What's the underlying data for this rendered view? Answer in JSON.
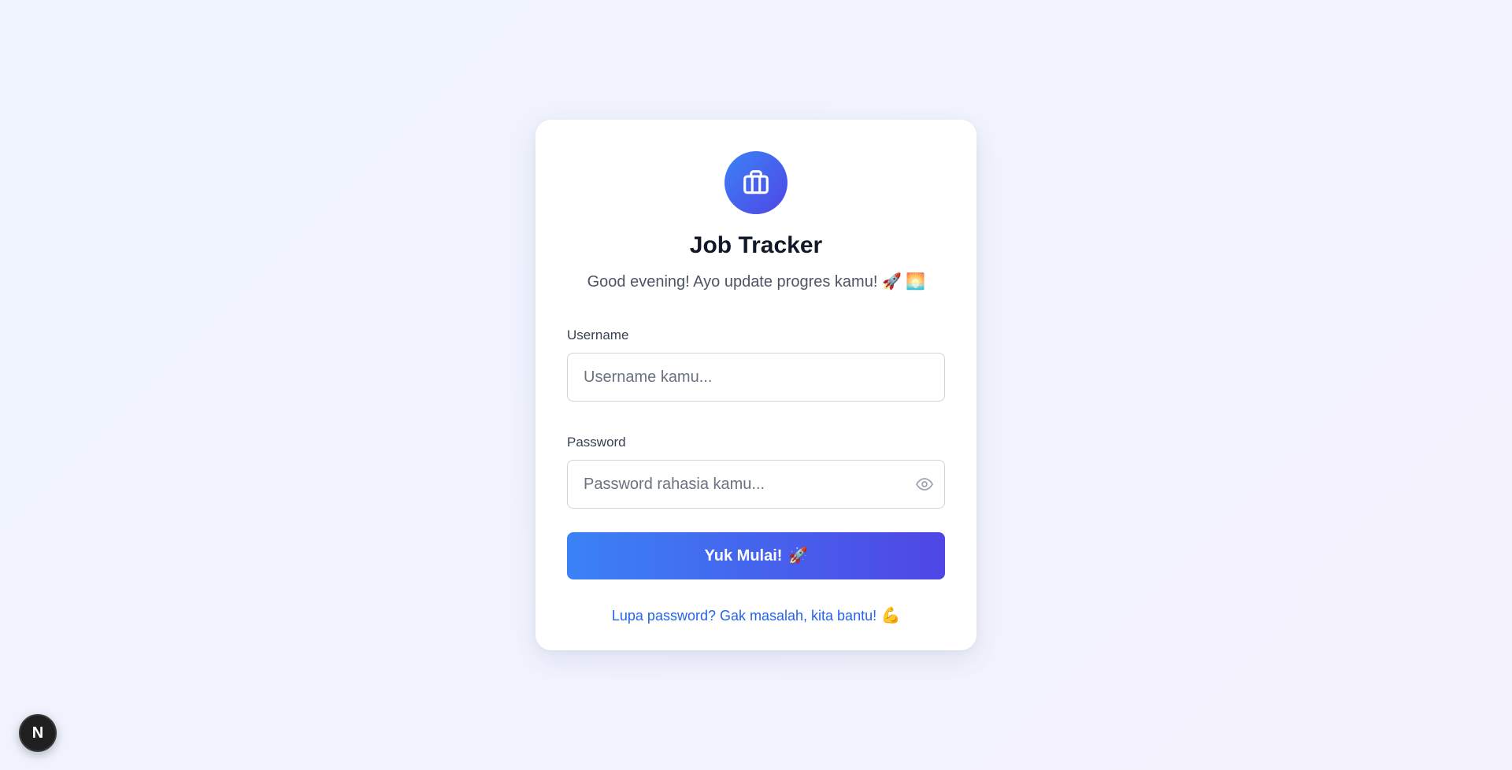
{
  "app": {
    "title": "Job Tracker",
    "greeting_text": "Good evening! Ayo update progres kamu!",
    "greeting_emojis": [
      "🚀",
      "🌅"
    ],
    "logo_icon": "briefcase-icon"
  },
  "form": {
    "username": {
      "label": "Username",
      "placeholder": "Username kamu...",
      "value": ""
    },
    "password": {
      "label": "Password",
      "placeholder": "Password rahasia kamu...",
      "value": "",
      "toggle_icon": "eye-icon"
    },
    "submit_label": "Yuk Mulai!",
    "submit_emoji": "🚀",
    "forgot_label": "Lupa password? Gak masalah, kita bantu!",
    "forgot_emoji": "💪"
  },
  "dev_badge": {
    "label": "N"
  },
  "colors": {
    "accent_start": "#3b82f6",
    "accent_end": "#4f46e5",
    "link": "#2563eb",
    "title": "#111827"
  }
}
